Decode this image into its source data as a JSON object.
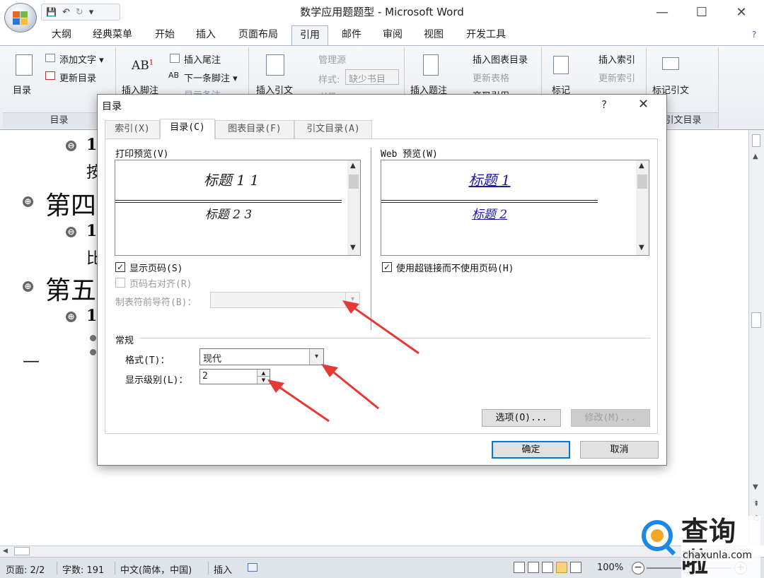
{
  "window": {
    "title": "数学应用题题型 - Microsoft Word",
    "minimize": "—",
    "maximize": "☐",
    "close": "✕"
  },
  "qat": {
    "save": "💾",
    "undo": "↶",
    "redo": "↻",
    "more": "▾"
  },
  "ribbon_tabs": [
    "大纲",
    "经典菜单",
    "开始",
    "插入",
    "页面布局",
    "引用",
    "邮件",
    "审阅",
    "视图",
    "开发工具"
  ],
  "active_ribbon_tab": "引用",
  "help_icon": "?",
  "ribbon": {
    "toc": {
      "big_label": "目录",
      "add_text": "添加文字 ▾",
      "update_toc": "更新目录",
      "group": "目录"
    },
    "footnotes": {
      "ab": "AB",
      "ab_sup": "1",
      "insert_footnote": "插入脚注",
      "insert_endnote": "插入尾注",
      "next_footnote": "下一条脚注 ▾",
      "show_notes": "显示备注"
    },
    "citations": {
      "insert_citation": "插入引文",
      "manage_sources": "管理源",
      "style_label": "样式:",
      "style_value": "缺少书目",
      "bibliography": "书目"
    },
    "captions": {
      "insert_caption": "插入题注",
      "insert_table_of_figures": "插入图表目录",
      "update_table": "更新表格",
      "cross_reference": "交叉引用"
    },
    "index": {
      "mark_entry": "标记",
      "insert_index": "插入索引",
      "update_index": "更新索引"
    },
    "toa": {
      "mark_citation": "标记引文",
      "group": "引文目录"
    }
  },
  "document": {
    "lines": [
      {
        "bullet": "⊖",
        "text": "1"
      },
      {
        "text": "按"
      },
      {
        "bullet": "⊕",
        "text": "第四"
      },
      {
        "bullet": "⊖",
        "text": "1"
      },
      {
        "text": "比"
      },
      {
        "bullet": "⊕",
        "text": "第五"
      },
      {
        "bullet": "⊕",
        "text": "1"
      },
      {
        "text": "—"
      }
    ]
  },
  "dialog": {
    "title": "目录",
    "help": "?",
    "close": "✕",
    "tabs": [
      "索引(X)",
      "目录(C)",
      "图表目录(F)",
      "引文目录(A)"
    ],
    "active_tab": "目录(C)",
    "print_preview": {
      "label": "打印预览(V)",
      "h1": "标题 1 1",
      "h2": "标题 2 3"
    },
    "web_preview": {
      "label": "Web 预览(W)",
      "h1": "标题 1",
      "h2": "标题 2"
    },
    "show_page_numbers": {
      "label": "显示页码(S)",
      "checked": true
    },
    "right_align": {
      "label": "页码右对齐(R)",
      "checked": false,
      "disabled": true
    },
    "tab_leader": {
      "label": "制表符前导符(B)：",
      "value": ""
    },
    "use_hyperlinks": {
      "label": "使用超链接而不使用页码(H)",
      "checked": true
    },
    "general": {
      "section": "常规",
      "format_label": "格式(T)：",
      "format_value": "现代",
      "levels_label": "显示级别(L)：",
      "levels_value": "2"
    },
    "buttons": {
      "options": "选项(O)...",
      "modify": "修改(M)...",
      "ok": "确定",
      "cancel": "取消"
    }
  },
  "statusbar": {
    "page": "页面: 2/2",
    "words": "字数: 191",
    "lang": "中文(简体，中国)",
    "mode": "插入",
    "zoom": "100%",
    "zoom_minus": "−",
    "zoom_plus": "+"
  },
  "watermark": {
    "text": "查询啦",
    "domain": "chaxunla.com"
  },
  "colors": {
    "accent": "#0078d7",
    "arrow": "#e53935",
    "hyperlink": "#1a1aa6",
    "ribbon_bg": "#e9ecf1"
  }
}
